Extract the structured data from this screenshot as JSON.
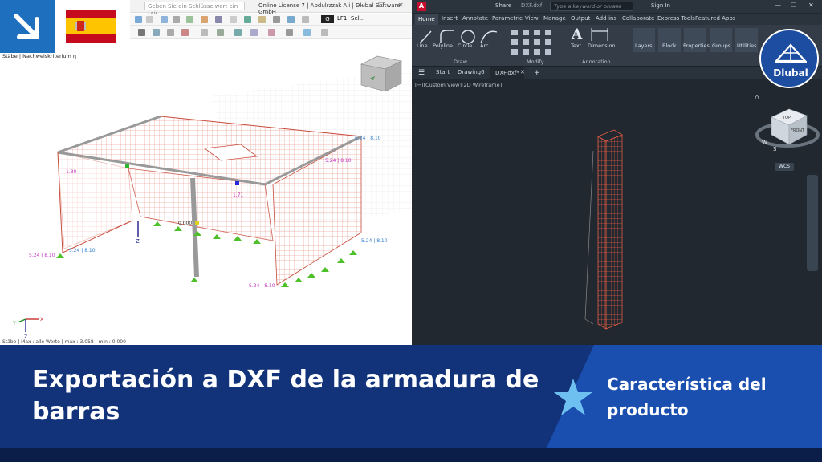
{
  "left_app": {
    "search_placeholder": "Geben Sie ein Schlüsselwort ein (Alt...",
    "license_title": "Online License 7 | Abdulrzzak Ali | Dlubal Software GmbH",
    "loadcase": "LF1",
    "loadcase_code": "G",
    "select_label": "Sel...",
    "context_label": "Stäbe | Nachweiskriterium η",
    "status_text": "Stäbe | Max : alle Werte | max : 3.058 | min : 0.000",
    "cube_label": "-Y",
    "labels": {
      "l1": "5.24 | 8.10",
      "l2": "5.24 | 8.10",
      "l3": "5.24 | 8.10",
      "l4": "5.24 | 8.10",
      "l5": "5.24 | 8.10",
      "l6": "5.24 | 8.10",
      "l7": "0.000",
      "l8": "1.71",
      "l9": "1.30"
    },
    "axis": {
      "x": "X",
      "y": "Y",
      "z": "Z"
    }
  },
  "right_app": {
    "logo": "A",
    "share": "Share",
    "file_title": "DXF.dxf",
    "search_placeholder": "Type a keyword or phrase",
    "sign_in": "Sign In",
    "menu": [
      "Home",
      "Insert",
      "Annotate",
      "Parametric",
      "View",
      "Manage",
      "Output",
      "Add-ins",
      "Collaborate",
      "Express Tools",
      "Featured Apps"
    ],
    "draw_tools": [
      "Line",
      "Polyline",
      "Circle",
      "Arc"
    ],
    "groups": {
      "draw": "Draw",
      "modify": "Modify",
      "annotation": "Annotation"
    },
    "annotation_tools": [
      "Text",
      "Dimension"
    ],
    "panels": [
      "Layers",
      "Block",
      "Properties",
      "Groups",
      "Utilities"
    ],
    "tabs": [
      "Start",
      "Drawing6",
      "DXF.dxf*"
    ],
    "view_label": "[−][Custom View][2D Wireframe]",
    "viewcube": {
      "top": "TOP",
      "front": "FRONT",
      "w": "W",
      "s": "S"
    },
    "wcs": "WCS"
  },
  "brand": {
    "name": "Dlubal",
    "accent": "#1a4fb0",
    "dark": "#12327a"
  },
  "banner": {
    "title": "Exportación a DXF de la armadura de barras",
    "subtitle": "Característica del producto"
  }
}
